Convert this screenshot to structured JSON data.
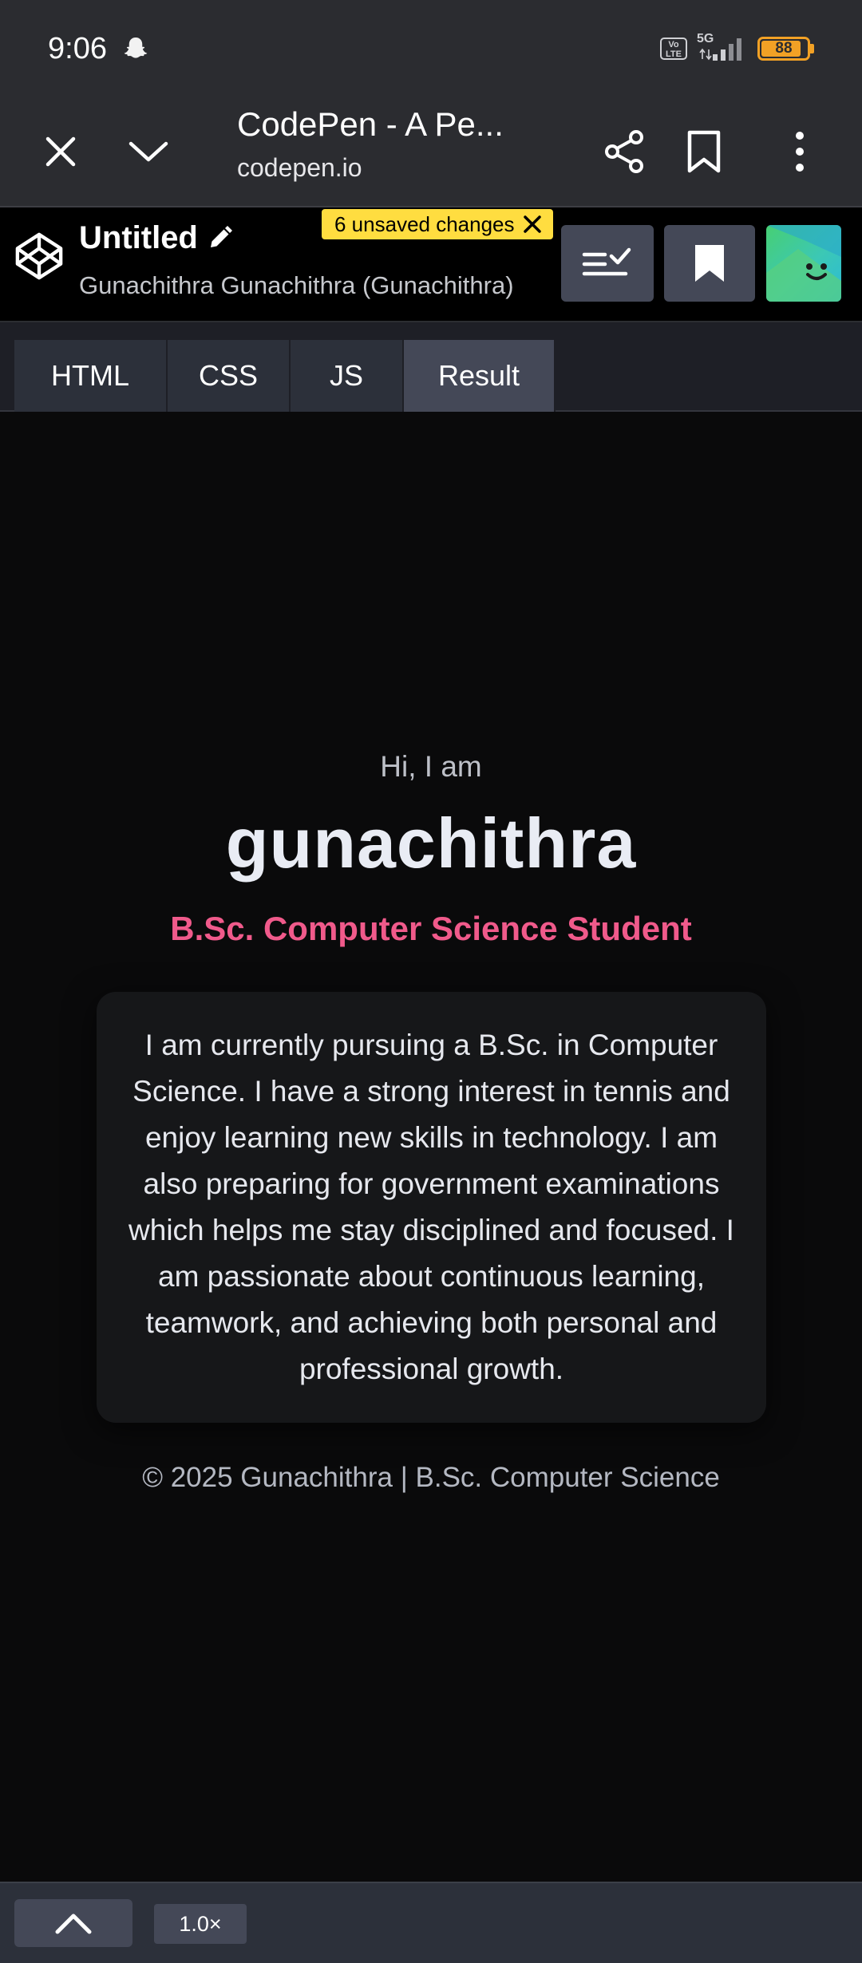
{
  "status_bar": {
    "time": "9:06",
    "network": "5G",
    "volte": "Vo LTE",
    "battery_level": "88",
    "battery_fraction": 0.88,
    "notification_icon": "snapchat-ghost-icon"
  },
  "browser": {
    "page_title": "CodePen - A Pe...",
    "url": "codepen.io",
    "icons": [
      "close-icon",
      "chevron-down-icon",
      "share-icon",
      "bookmark-icon",
      "more-vert-icon"
    ]
  },
  "codepen": {
    "pen_title": "Untitled",
    "author": "Gunachithra Gunachithra (Gunachithra)",
    "unsaved_badge": "6 unsaved changes",
    "icons": [
      "codepen-logo-icon",
      "pencil-icon",
      "layout-icon",
      "bookmark-icon",
      "avatar"
    ]
  },
  "tabs": [
    {
      "label": "HTML",
      "active": false
    },
    {
      "label": "CSS",
      "active": false
    },
    {
      "label": "JS",
      "active": false
    },
    {
      "label": "Result",
      "active": true
    }
  ],
  "result": {
    "greeting": "Hi, I am",
    "name": "gunachithra",
    "subtitle": "B.Sc. Computer Science Student",
    "about": "I am currently pursuing a B.Sc. in Computer Science. I have a strong interest in tennis and enjoy learning new skills in technology. I am also preparing for government examinations which helps me stay disciplined and focused. I am passionate about continuous learning, teamwork, and achieving both personal and professional growth.",
    "footer": "© 2025 Gunachithra | B.Sc. Computer Science"
  },
  "bottom_bar": {
    "zoom": "1.0×",
    "toggle_icon": "chevron-up-icon"
  },
  "colors": {
    "accent_pink": "#f05a8b",
    "badge_yellow": "#ffdd40",
    "battery": "#f2a125"
  }
}
